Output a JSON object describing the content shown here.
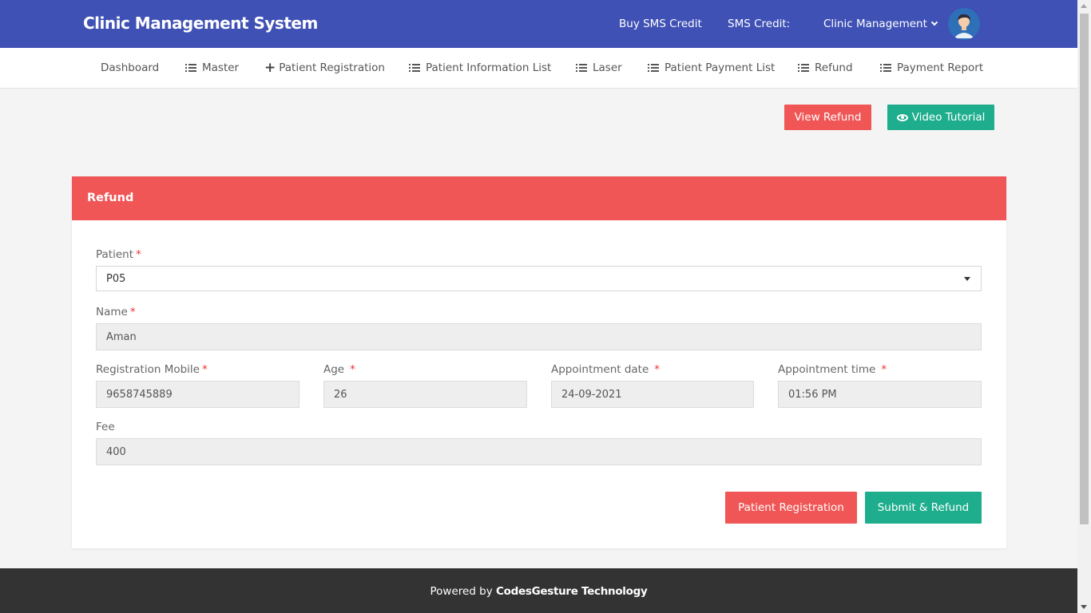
{
  "header": {
    "brand": "Clinic Management System",
    "buy_sms": "Buy SMS Credit",
    "sms_credit": "SMS Credit:",
    "user_menu": "Clinic Management"
  },
  "nav": {
    "items": [
      {
        "label": "Dashboard",
        "icon": "none"
      },
      {
        "label": "Master",
        "icon": "list-icon"
      },
      {
        "label": "Patient Registration",
        "icon": "plus-icon"
      },
      {
        "label": "Patient Information List",
        "icon": "list-icon"
      },
      {
        "label": "Laser",
        "icon": "list-icon"
      },
      {
        "label": "Patient Payment List",
        "icon": "list-icon"
      },
      {
        "label": "Refund",
        "icon": "list-icon"
      },
      {
        "label": "Payment Report",
        "icon": "list-icon"
      }
    ]
  },
  "actions": {
    "view_refund": "View Refund",
    "video_tutorial": "Video Tutorial"
  },
  "card": {
    "title": "Refund"
  },
  "form": {
    "patient": {
      "label": "Patient",
      "value": "P05"
    },
    "name": {
      "label": "Name",
      "value": "Aman"
    },
    "mobile": {
      "label": "Registration Mobile",
      "value": "9658745889"
    },
    "age": {
      "label": "Age",
      "value": "26"
    },
    "appt_date": {
      "label": "Appointment date",
      "value": "24-09-2021"
    },
    "appt_time": {
      "label": "Appointment time",
      "value": "01:56 PM"
    },
    "fee": {
      "label": "Fee",
      "value": "400"
    },
    "required_mark": "*",
    "patient_registration_btn": "Patient Registration",
    "submit_btn": "Submit & Refund"
  },
  "footer": {
    "prefix": "Powered by",
    "company": "CodesGesture Technology"
  },
  "colors": {
    "header_bg": "#3f51b5",
    "accent_red": "#f05656",
    "accent_teal": "#1eae8d",
    "footer_bg": "#333333"
  }
}
